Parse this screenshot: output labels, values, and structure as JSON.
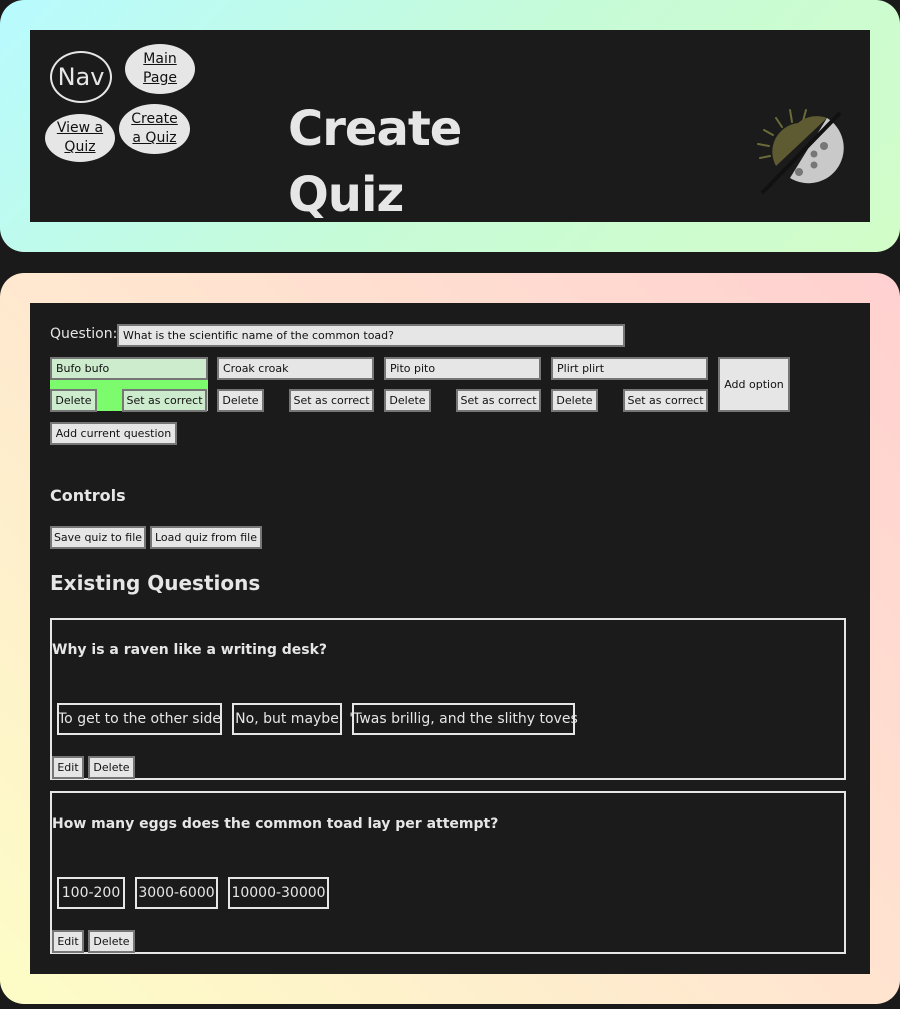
{
  "header": {
    "nav_label": "Nav",
    "links": {
      "main_page": "Main Page",
      "view_quiz": "View a Quiz",
      "create_quiz": "Create a Quiz"
    },
    "title": "Create Quiz",
    "theme_toggle_icon": "sun-moon-toggle-icon"
  },
  "editor": {
    "question_label": "Question:",
    "question_value": "What is the scientific name of the common toad?",
    "options": [
      {
        "value": "Bufo bufo",
        "delete_label": "Delete",
        "correct_label": "Set as correct",
        "is_correct": true
      },
      {
        "value": "Croak croak",
        "delete_label": "Delete",
        "correct_label": "Set as correct",
        "is_correct": false
      },
      {
        "value": "Pito pito",
        "delete_label": "Delete",
        "correct_label": "Set as correct",
        "is_correct": false
      },
      {
        "value": "Plirt plirt",
        "delete_label": "Delete",
        "correct_label": "Set as correct",
        "is_correct": false
      }
    ],
    "add_option_label": "Add option",
    "add_question_label": "Add current question",
    "correct_color": "#7cfc6c"
  },
  "controls": {
    "heading": "Controls",
    "save_label": "Save quiz to file",
    "load_label": "Load quiz from file"
  },
  "existing": {
    "heading": "Existing Questions",
    "questions": [
      {
        "text": "Why is a raven like a writing desk?",
        "answers": [
          "To get to the other side",
          "No, but maybe",
          "'Twas brillig, and the slithy toves"
        ],
        "edit_label": "Edit",
        "delete_label": "Delete"
      },
      {
        "text": "How many eggs does the common toad lay per attempt?",
        "answers": [
          "100-200",
          "3000-6000",
          "10000-30000"
        ],
        "edit_label": "Edit",
        "delete_label": "Delete"
      }
    ]
  }
}
